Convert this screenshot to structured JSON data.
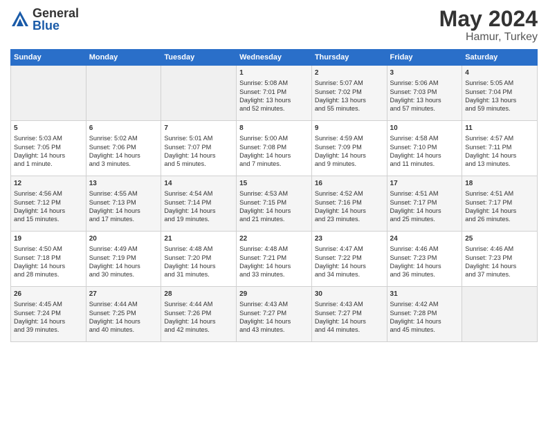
{
  "logo": {
    "general": "General",
    "blue": "Blue"
  },
  "title": {
    "month": "May 2024",
    "location": "Hamur, Turkey"
  },
  "headers": [
    "Sunday",
    "Monday",
    "Tuesday",
    "Wednesday",
    "Thursday",
    "Friday",
    "Saturday"
  ],
  "weeks": [
    [
      {
        "day": "",
        "info": ""
      },
      {
        "day": "",
        "info": ""
      },
      {
        "day": "",
        "info": ""
      },
      {
        "day": "1",
        "info": "Sunrise: 5:08 AM\nSunset: 7:01 PM\nDaylight: 13 hours\nand 52 minutes."
      },
      {
        "day": "2",
        "info": "Sunrise: 5:07 AM\nSunset: 7:02 PM\nDaylight: 13 hours\nand 55 minutes."
      },
      {
        "day": "3",
        "info": "Sunrise: 5:06 AM\nSunset: 7:03 PM\nDaylight: 13 hours\nand 57 minutes."
      },
      {
        "day": "4",
        "info": "Sunrise: 5:05 AM\nSunset: 7:04 PM\nDaylight: 13 hours\nand 59 minutes."
      }
    ],
    [
      {
        "day": "5",
        "info": "Sunrise: 5:03 AM\nSunset: 7:05 PM\nDaylight: 14 hours\nand 1 minute."
      },
      {
        "day": "6",
        "info": "Sunrise: 5:02 AM\nSunset: 7:06 PM\nDaylight: 14 hours\nand 3 minutes."
      },
      {
        "day": "7",
        "info": "Sunrise: 5:01 AM\nSunset: 7:07 PM\nDaylight: 14 hours\nand 5 minutes."
      },
      {
        "day": "8",
        "info": "Sunrise: 5:00 AM\nSunset: 7:08 PM\nDaylight: 14 hours\nand 7 minutes."
      },
      {
        "day": "9",
        "info": "Sunrise: 4:59 AM\nSunset: 7:09 PM\nDaylight: 14 hours\nand 9 minutes."
      },
      {
        "day": "10",
        "info": "Sunrise: 4:58 AM\nSunset: 7:10 PM\nDaylight: 14 hours\nand 11 minutes."
      },
      {
        "day": "11",
        "info": "Sunrise: 4:57 AM\nSunset: 7:11 PM\nDaylight: 14 hours\nand 13 minutes."
      }
    ],
    [
      {
        "day": "12",
        "info": "Sunrise: 4:56 AM\nSunset: 7:12 PM\nDaylight: 14 hours\nand 15 minutes."
      },
      {
        "day": "13",
        "info": "Sunrise: 4:55 AM\nSunset: 7:13 PM\nDaylight: 14 hours\nand 17 minutes."
      },
      {
        "day": "14",
        "info": "Sunrise: 4:54 AM\nSunset: 7:14 PM\nDaylight: 14 hours\nand 19 minutes."
      },
      {
        "day": "15",
        "info": "Sunrise: 4:53 AM\nSunset: 7:15 PM\nDaylight: 14 hours\nand 21 minutes."
      },
      {
        "day": "16",
        "info": "Sunrise: 4:52 AM\nSunset: 7:16 PM\nDaylight: 14 hours\nand 23 minutes."
      },
      {
        "day": "17",
        "info": "Sunrise: 4:51 AM\nSunset: 7:17 PM\nDaylight: 14 hours\nand 25 minutes."
      },
      {
        "day": "18",
        "info": "Sunrise: 4:51 AM\nSunset: 7:17 PM\nDaylight: 14 hours\nand 26 minutes."
      }
    ],
    [
      {
        "day": "19",
        "info": "Sunrise: 4:50 AM\nSunset: 7:18 PM\nDaylight: 14 hours\nand 28 minutes."
      },
      {
        "day": "20",
        "info": "Sunrise: 4:49 AM\nSunset: 7:19 PM\nDaylight: 14 hours\nand 30 minutes."
      },
      {
        "day": "21",
        "info": "Sunrise: 4:48 AM\nSunset: 7:20 PM\nDaylight: 14 hours\nand 31 minutes."
      },
      {
        "day": "22",
        "info": "Sunrise: 4:48 AM\nSunset: 7:21 PM\nDaylight: 14 hours\nand 33 minutes."
      },
      {
        "day": "23",
        "info": "Sunrise: 4:47 AM\nSunset: 7:22 PM\nDaylight: 14 hours\nand 34 minutes."
      },
      {
        "day": "24",
        "info": "Sunrise: 4:46 AM\nSunset: 7:23 PM\nDaylight: 14 hours\nand 36 minutes."
      },
      {
        "day": "25",
        "info": "Sunrise: 4:46 AM\nSunset: 7:23 PM\nDaylight: 14 hours\nand 37 minutes."
      }
    ],
    [
      {
        "day": "26",
        "info": "Sunrise: 4:45 AM\nSunset: 7:24 PM\nDaylight: 14 hours\nand 39 minutes."
      },
      {
        "day": "27",
        "info": "Sunrise: 4:44 AM\nSunset: 7:25 PM\nDaylight: 14 hours\nand 40 minutes."
      },
      {
        "day": "28",
        "info": "Sunrise: 4:44 AM\nSunset: 7:26 PM\nDaylight: 14 hours\nand 42 minutes."
      },
      {
        "day": "29",
        "info": "Sunrise: 4:43 AM\nSunset: 7:27 PM\nDaylight: 14 hours\nand 43 minutes."
      },
      {
        "day": "30",
        "info": "Sunrise: 4:43 AM\nSunset: 7:27 PM\nDaylight: 14 hours\nand 44 minutes."
      },
      {
        "day": "31",
        "info": "Sunrise: 4:42 AM\nSunset: 7:28 PM\nDaylight: 14 hours\nand 45 minutes."
      },
      {
        "day": "",
        "info": ""
      }
    ]
  ]
}
